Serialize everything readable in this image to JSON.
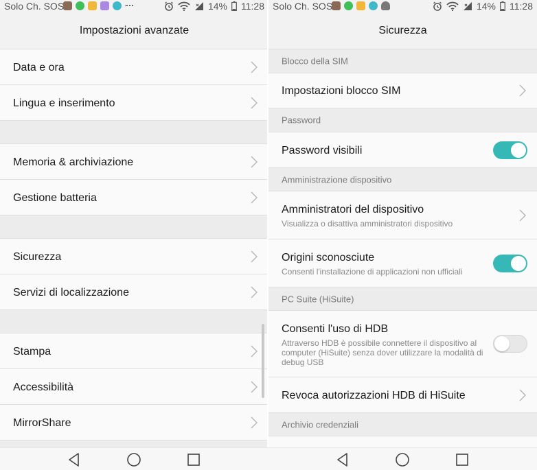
{
  "status_bar": {
    "carrier": "Solo Ch. SOS",
    "battery": "14%",
    "time": "11:28"
  },
  "left_screen": {
    "title": "Impostazioni avanzate",
    "items": [
      {
        "label": "Data e ora"
      },
      {
        "label": "Lingua e inserimento"
      },
      {
        "label": "Memoria & archiviazione"
      },
      {
        "label": "Gestione batteria"
      },
      {
        "label": "Sicurezza"
      },
      {
        "label": "Servizi di localizzazione"
      },
      {
        "label": "Stampa"
      },
      {
        "label": "Accessibilità"
      },
      {
        "label": "MirrorShare"
      }
    ]
  },
  "right_screen": {
    "title": "Sicurezza",
    "sections": {
      "sim": "Blocco della SIM",
      "password": "Password",
      "admin": "Amministrazione dispositivo",
      "pcsuite": "PC Suite (HiSuite)",
      "credentials": "Archivio credenziali"
    },
    "items": {
      "sim_lock": {
        "label": "Impostazioni blocco SIM"
      },
      "show_password": {
        "label": "Password visibili",
        "enabled": true
      },
      "device_admins": {
        "label": "Amministratori del dispositivo",
        "sub": "Visualizza o disattiva amministratori dispositivo"
      },
      "unknown_sources": {
        "label": "Origini sconosciute",
        "sub": "Consenti l'installazione di applicazioni non ufficiali",
        "enabled": true
      },
      "hdb": {
        "label": "Consenti l'uso di HDB",
        "sub": "Attraverso HDB è possibile connettere il dispositivo al computer (HiSuite) senza dover utilizzare la modalità di debug USB",
        "enabled": false
      },
      "revoke_hdb": {
        "label": "Revoca autorizzazioni HDB di HiSuite"
      }
    }
  },
  "colors": {
    "accent": "#35b8b6",
    "row_bg": "#fafafa",
    "section_bg": "#ececec"
  },
  "icons": [
    "wifi-icon",
    "alarm-icon",
    "battery-icon",
    "chevron-right-icon",
    "nav-back-icon",
    "nav-home-icon",
    "nav-recents-icon"
  ]
}
